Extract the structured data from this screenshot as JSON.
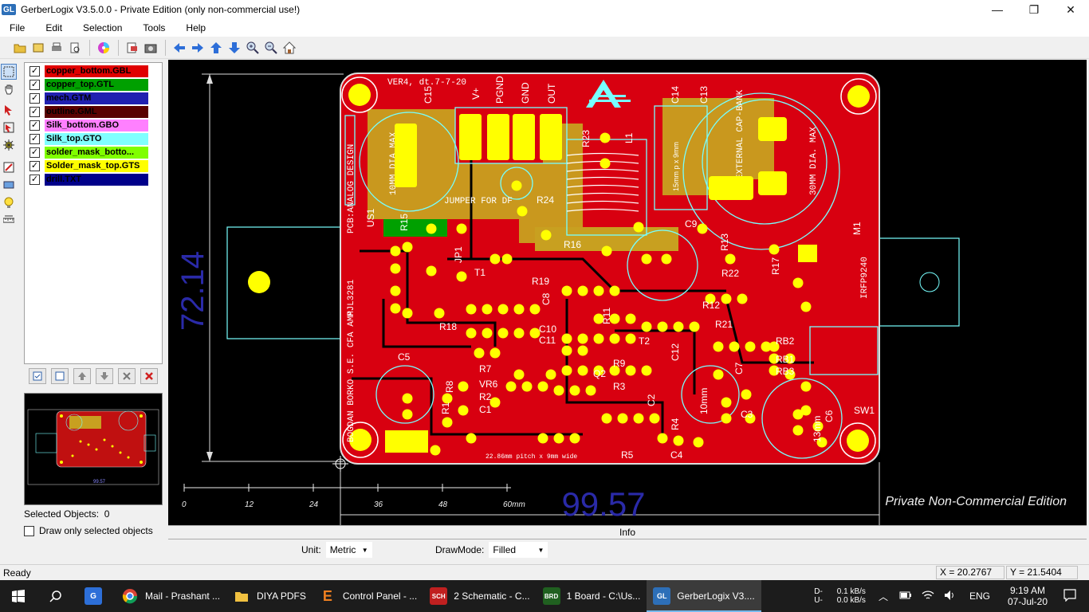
{
  "window": {
    "logo": "GL",
    "title": "GerberLogix V3.5.0.0  -  Private Edition (only non-commercial use!)",
    "controls": [
      "—",
      "❐",
      "✕"
    ]
  },
  "menu": [
    "File",
    "Edit",
    "Selection",
    "Tools",
    "Help"
  ],
  "layers": [
    {
      "name": "copper_bottom.GBL",
      "color": "#e00000",
      "text": "#000"
    },
    {
      "name": "copper_top.GTL",
      "color": "#00a000",
      "text": "#000"
    },
    {
      "name": "mech.GTM",
      "color": "#2020b0",
      "text": "#000"
    },
    {
      "name": "outline.GML",
      "color": "#5a0000",
      "text": "#000"
    },
    {
      "name": "Silk_bottom.GBO",
      "color": "#ff80ff",
      "text": "#000"
    },
    {
      "name": "Silk_top.GTO",
      "color": "#80ffff",
      "text": "#000"
    },
    {
      "name": "solder_mask_botto...",
      "color": "#80ff00",
      "text": "#000"
    },
    {
      "name": "Solder_mask_top.GTS",
      "color": "#ffff00",
      "text": "#000"
    },
    {
      "name": "drill.TXT",
      "color": "#00008a",
      "text": "#000"
    }
  ],
  "selection": {
    "label": "Selected Objects:",
    "count": "0"
  },
  "draw_only": "Draw only selected objects",
  "canvas": {
    "dim_vertical": "72.14",
    "dim_horizontal": "99.57",
    "ruler_ticks": [
      "0",
      "12",
      "24",
      "36",
      "48",
      "60mm"
    ],
    "watermark": "Private Non-Commercial Edition",
    "board_labels": {
      "version": "VER4, dt.7-7-20",
      "designer": "BOGDAN BORKO S.E. CFA AMP",
      "pcb": "PCB:ANALOG DESIGN",
      "cap_left": "10MM DIA MAX",
      "cap_right": "30MM DIA. MAX",
      "ext_cap": "EXTERNAL CAP-BANK",
      "jumper": "JUMPER FOR DF",
      "transistor_left": "MJL3281",
      "transistor_right": "IRFP9240",
      "pitch": "22.86mm pitch x 9mm wide",
      "components": [
        "C15",
        "V+",
        "PGND",
        "GND",
        "OUT",
        "C14",
        "C13",
        "R23",
        "L1",
        "R24",
        "R15",
        "R16",
        "C9",
        "R13",
        "R17",
        "M1",
        "US1",
        "JP1",
        "T1",
        "R19",
        "C8",
        "R22",
        "R18",
        "R12",
        "C10",
        "C11",
        "R21",
        "T2",
        "R11",
        "C12",
        "RB2",
        "RB1",
        "RB3",
        "C5",
        "R7",
        "R8",
        "VR6",
        "R2",
        "Q2",
        "R3",
        "C2",
        "C7",
        "R9",
        "R1",
        "C1",
        "R5",
        "R4",
        "C4",
        "C3",
        "C6",
        "SW1",
        "15mm p x 9mm",
        "13mm",
        "10mm"
      ]
    }
  },
  "info_label": "Info",
  "unit": {
    "label": "Unit:",
    "value": "Metric"
  },
  "drawmode": {
    "label": "DrawMode:",
    "value": "Filled"
  },
  "status": {
    "ready": "Ready",
    "x": "X = 20.2767",
    "y": "Y = 21.5404"
  },
  "taskbar": {
    "apps": [
      {
        "label": "",
        "icon": "chrome-app"
      },
      {
        "label": "Mail - Prashant ...",
        "icon": "chrome"
      },
      {
        "label": "DIYA PDFS",
        "icon": "folder"
      },
      {
        "label": "Control Panel - ...",
        "icon": "E"
      },
      {
        "label": "2 Schematic - C...",
        "icon": "SCH"
      },
      {
        "label": "1 Board - C:\\Us...",
        "icon": "BRD"
      },
      {
        "label": "GerberLogix V3....",
        "icon": "GL"
      }
    ],
    "net_up": "D-",
    "net_down": "U-",
    "speed_up": "0.1 kB/s",
    "speed_down": "0.0 kB/s",
    "lang": "ENG",
    "time": "9:19 AM",
    "date": "07-Jul-20"
  }
}
